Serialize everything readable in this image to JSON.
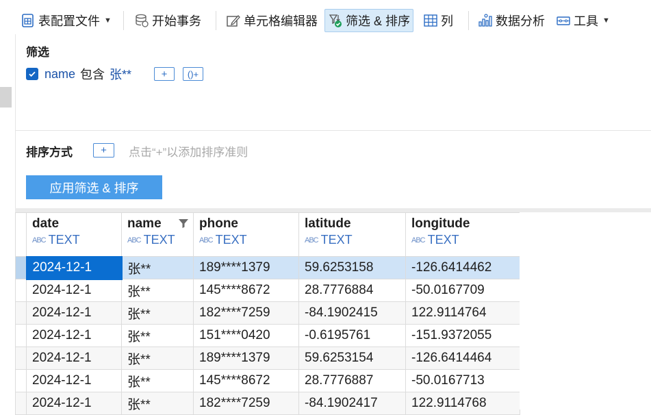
{
  "toolbar": {
    "items": [
      {
        "label": "表配置文件",
        "icon": "table-config-icon",
        "has_dropdown": true
      },
      {
        "label": "开始事务",
        "icon": "database-transaction-icon"
      },
      {
        "label": "单元格编辑器",
        "icon": "cell-editor-icon"
      },
      {
        "label": "筛选 & 排序",
        "icon": "filter-sort-icon",
        "active": true
      },
      {
        "label": "列",
        "icon": "columns-grid-icon"
      },
      {
        "label": "数据分析",
        "icon": "data-analysis-icon"
      },
      {
        "label": "工具",
        "icon": "tools-icon",
        "has_dropdown": true
      }
    ]
  },
  "filter": {
    "title": "筛选",
    "conditions": [
      {
        "checked": true,
        "column": "name",
        "operator": "包含",
        "value": "张**"
      }
    ],
    "add_condition_label": "+",
    "add_group_label": "()+"
  },
  "sort": {
    "title": "排序方式",
    "add_label": "+",
    "hint": "点击“+”以添加排序准则"
  },
  "apply_button": {
    "label": "应用筛选 & 排序"
  },
  "colors": {
    "accent": "#4a9de9",
    "selected_cell": "#0a6ed1",
    "selected_row": "#cfe3f7",
    "header_selected": "#b6d5f2",
    "link_text": "#1a52a8"
  },
  "table": {
    "columns": [
      {
        "name": "date",
        "type": "TEXT",
        "selected": true
      },
      {
        "name": "name",
        "type": "TEXT",
        "filtered": true
      },
      {
        "name": "phone",
        "type": "TEXT"
      },
      {
        "name": "latitude",
        "type": "TEXT"
      },
      {
        "name": "longitude",
        "type": "TEXT"
      }
    ],
    "type_badge": "ABC",
    "rows": [
      [
        "2024-12-1",
        "张**",
        "189****1379",
        "59.6253158",
        "-126.6414462"
      ],
      [
        "2024-12-1",
        "张**",
        "145****8672",
        "28.7776884",
        "-50.0167709"
      ],
      [
        "2024-12-1",
        "张**",
        "182****7259",
        "-84.1902415",
        "122.9114764"
      ],
      [
        "2024-12-1",
        "张**",
        "151****0420",
        "-0.6195761",
        "-151.9372055"
      ],
      [
        "2024-12-1",
        "张**",
        "189****1379",
        "59.6253154",
        "-126.6414464"
      ],
      [
        "2024-12-1",
        "张**",
        "145****8672",
        "28.7776887",
        "-50.0167713"
      ],
      [
        "2024-12-1",
        "张**",
        "182****7259",
        "-84.1902417",
        "122.9114768"
      ]
    ],
    "selected_row": 0
  }
}
